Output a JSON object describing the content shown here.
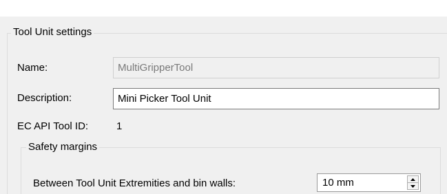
{
  "tool_unit_settings": {
    "title": "Tool Unit settings",
    "name_label": "Name:",
    "name_value": "MultiGripperTool",
    "description_label": "Description:",
    "description_value": "Mini Picker Tool Unit",
    "ec_api_label": "EC API Tool ID:",
    "ec_api_value": "1"
  },
  "safety_margins": {
    "title": "Safety margins",
    "bin_walls_label": "Between Tool Unit Extremities and bin walls:",
    "bin_walls_value": "10 mm",
    "spin_up_icon": "arrow-up-icon",
    "spin_down_icon": "arrow-down-icon"
  },
  "colors": {
    "panel_background": "#f0f0f0",
    "group_border": "#dcdcdc",
    "disabled_text": "#7a7a7a"
  }
}
